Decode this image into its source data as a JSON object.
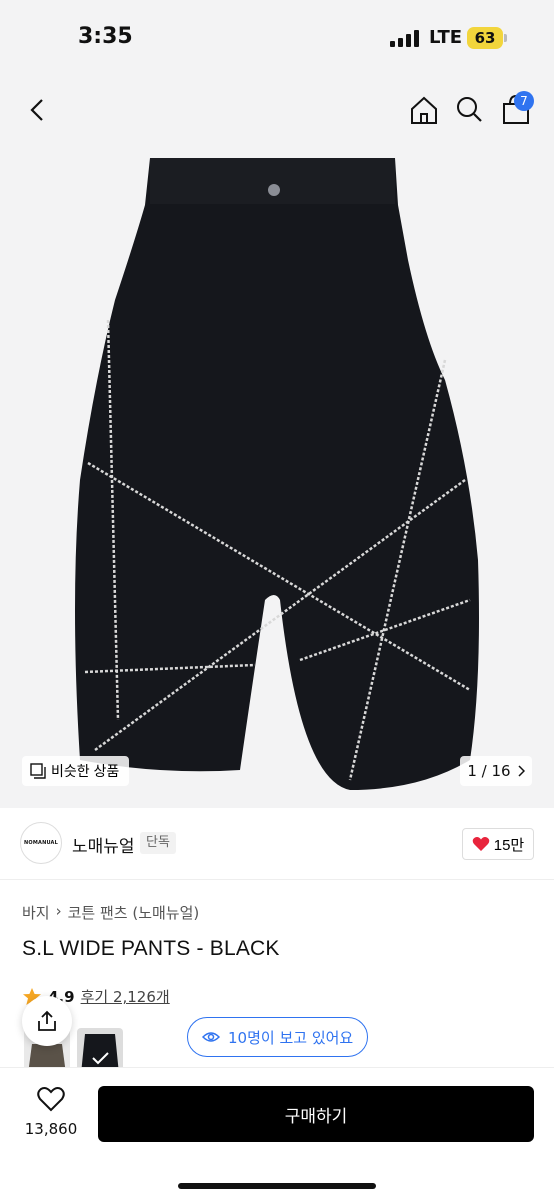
{
  "status_bar": {
    "time": "3:35",
    "network": "LTE",
    "battery": "63"
  },
  "nav": {
    "cart_count": "7"
  },
  "gallery": {
    "similar_label": "비슷한 상품",
    "page": "1 / 16"
  },
  "brand": {
    "logo_text": "NOMANUAL",
    "name": "노매뉴얼",
    "tag": "단독",
    "likes": "15만"
  },
  "breadcrumb": [
    "바지",
    "코튼 팬츠 (노매뉴얼)"
  ],
  "product": {
    "title": "S.L WIDE PANTS - BLACK",
    "rating": "4.9",
    "reviews": "후기 2,126개"
  },
  "viewing": "10명이 보고 있어요",
  "bottom": {
    "wish_count": "13,860",
    "buy_label": "구매하기"
  },
  "colors": {
    "accent": "#2f73f0",
    "heart": "#e8243c",
    "star": "#f5a623",
    "buy": "#000000"
  }
}
